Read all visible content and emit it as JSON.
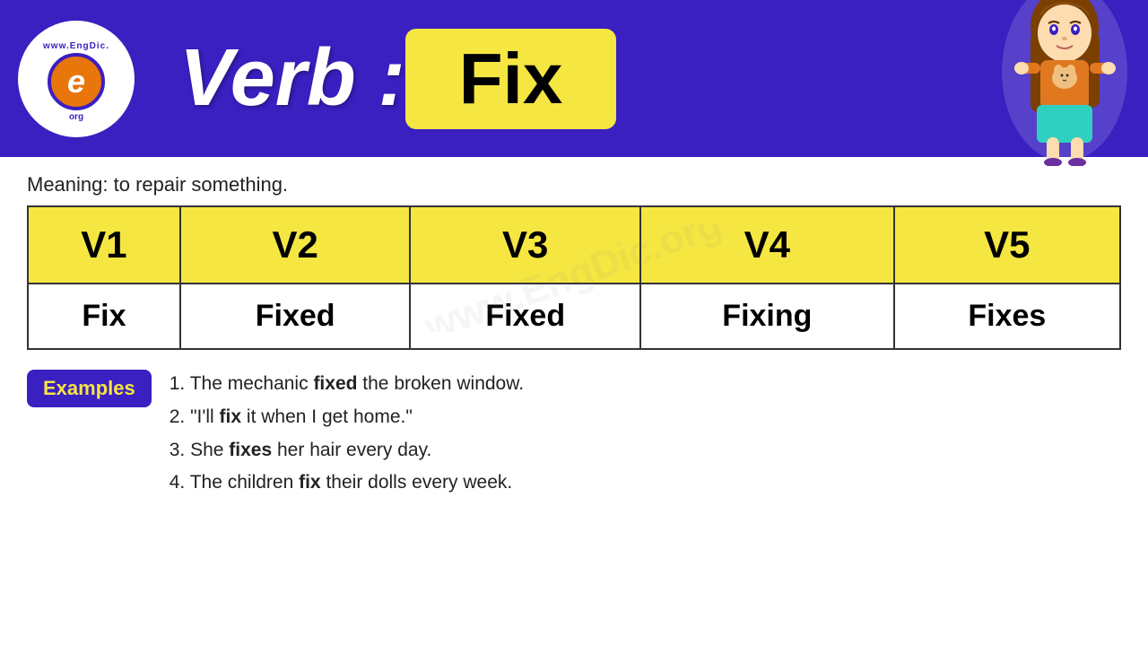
{
  "header": {
    "logo": {
      "url_text": "www.EngDic.org",
      "e_letter": "e"
    },
    "verb_label": "Verb :",
    "word": "Fix"
  },
  "meaning": {
    "label": "Meaning: to repair something."
  },
  "table": {
    "headers": [
      "V1",
      "V2",
      "V3",
      "V4",
      "V5"
    ],
    "values": [
      "Fix",
      "Fixed",
      "Fixed",
      "Fixing",
      "Fixes"
    ]
  },
  "examples": {
    "badge_label": "Examples",
    "items": [
      {
        "text": "1. The mechanic ",
        "bold": "fixed",
        "rest": " the broken window."
      },
      {
        "text": "2. \"I'll ",
        "bold": "fix",
        "rest": " it when I get home.\""
      },
      {
        "text": "3. She ",
        "bold": "fixes",
        "rest": " her hair every day."
      },
      {
        "text": "4. The children ",
        "bold": "fix",
        "rest": " their dolls every week."
      }
    ]
  }
}
